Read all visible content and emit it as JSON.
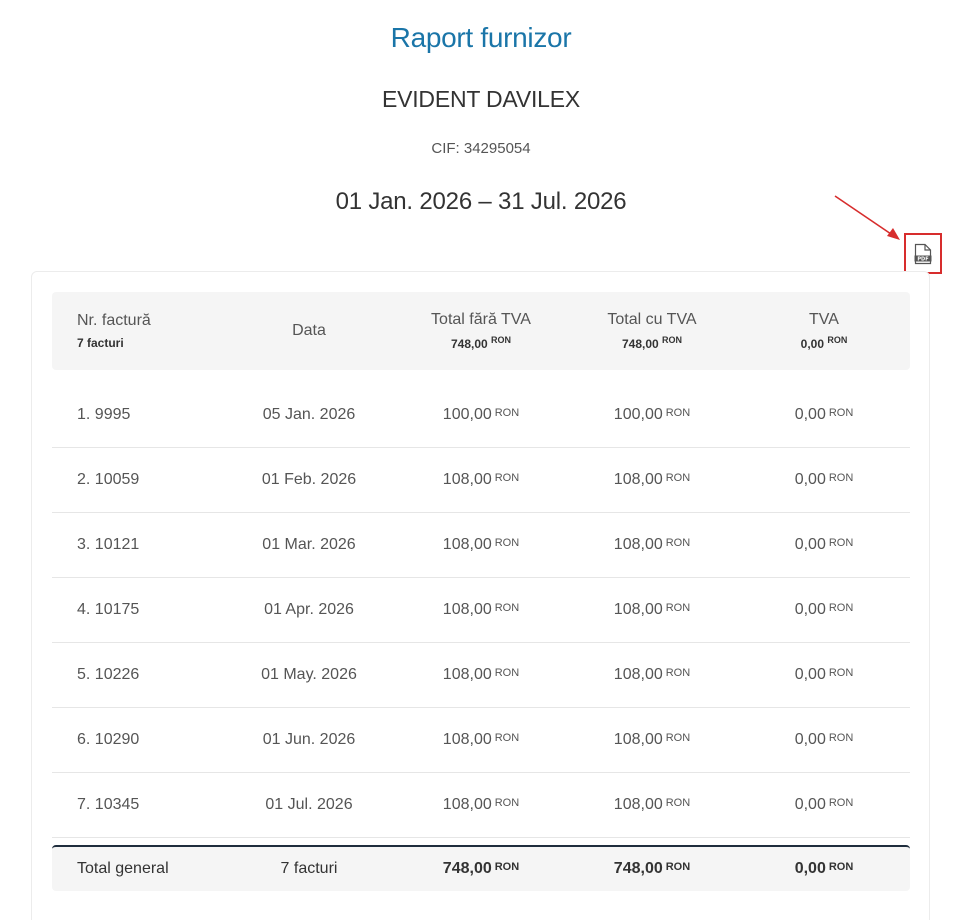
{
  "report": {
    "title": "Raport furnizor",
    "company": "EVIDENT DAVILEX",
    "cif": "CIF: 34295054",
    "period": "01 Jan. 2026 – 31 Jul. 2026"
  },
  "pdf_button": {
    "icon": "pdf-file-icon",
    "label": "PDF"
  },
  "colors": {
    "title": "#1a75a8",
    "highlight": "#d72d2d",
    "total_border": "#1f2d3d",
    "header_bg": "#f5f5f5"
  },
  "table": {
    "headers": {
      "nr": "Nr. factură",
      "nr_sub": "7 facturi",
      "data": "Data",
      "total_fara": "Total fără TVA",
      "total_fara_sub": "748,00",
      "total_cu": "Total cu TVA",
      "total_cu_sub": "748,00",
      "tva": "TVA",
      "tva_sub": "0,00",
      "currency": "RON"
    },
    "rows": [
      {
        "nr": "1. 9995",
        "data": "05 Jan. 2026",
        "total_fara": "100,00",
        "total_cu": "100,00",
        "tva": "0,00"
      },
      {
        "nr": "2. 10059",
        "data": "01 Feb. 2026",
        "total_fara": "108,00",
        "total_cu": "108,00",
        "tva": "0,00"
      },
      {
        "nr": "3. 10121",
        "data": "01 Mar. 2026",
        "total_fara": "108,00",
        "total_cu": "108,00",
        "tva": "0,00"
      },
      {
        "nr": "4. 10175",
        "data": "01 Apr. 2026",
        "total_fara": "108,00",
        "total_cu": "108,00",
        "tva": "0,00"
      },
      {
        "nr": "5. 10226",
        "data": "01 May. 2026",
        "total_fara": "108,00",
        "total_cu": "108,00",
        "tva": "0,00"
      },
      {
        "nr": "6. 10290",
        "data": "01 Jun. 2026",
        "total_fara": "108,00",
        "total_cu": "108,00",
        "tva": "0,00"
      },
      {
        "nr": "7. 10345",
        "data": "01 Jul. 2026",
        "total_fara": "108,00",
        "total_cu": "108,00",
        "tva": "0,00"
      }
    ],
    "total": {
      "label": "Total general",
      "count": "7 facturi",
      "total_fara": "748,00",
      "total_cu": "748,00",
      "tva": "0,00"
    }
  }
}
